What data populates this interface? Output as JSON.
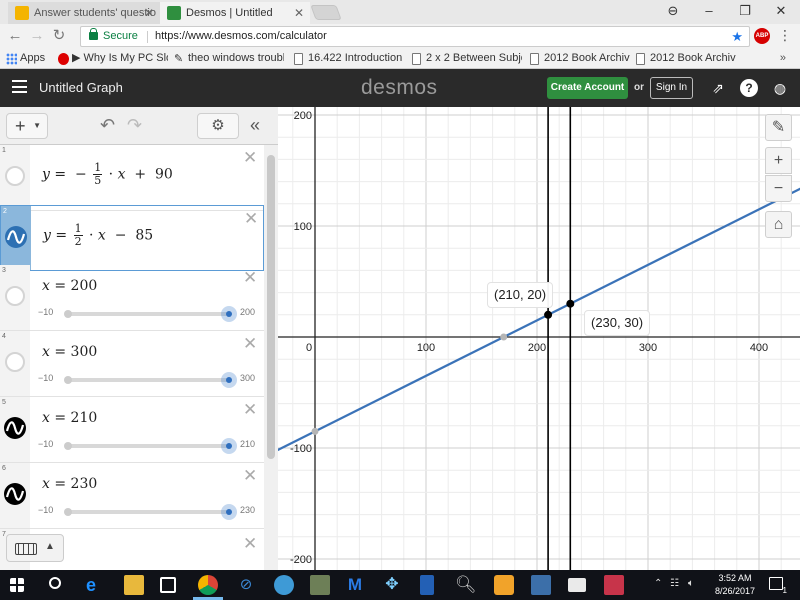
{
  "browser": {
    "tabs": [
      {
        "title": "Answer students' questio",
        "favicon_color": "#f4b400",
        "active": false
      },
      {
        "title": "Desmos | Untitled",
        "favicon_color": "#2f8f3f",
        "active": true
      }
    ],
    "secure_label": "Secure",
    "url": "https://www.desmos.com/calculator",
    "abp_label": "ABP",
    "bookmarks": [
      {
        "label": "Apps",
        "icon": "apps-icon"
      },
      {
        "label": "▶ Why Is My PC Slov",
        "icon": "power-icon"
      },
      {
        "label": "theo windows trouble",
        "icon": "bookmark-icon"
      },
      {
        "label": "16.422 Introduction",
        "icon": "page-icon"
      },
      {
        "label": "2 x 2 Between Subjec",
        "icon": "page-icon"
      },
      {
        "label": "2012 Book Archive",
        "icon": "page-icon"
      },
      {
        "label": "2012 Book Archive",
        "icon": "page-icon"
      }
    ],
    "bookmarks_more": "»"
  },
  "header": {
    "graph_title": "Untitled Graph",
    "logo": "desmos",
    "create_account": "Create Account",
    "or": "or",
    "sign_in": "Sign In"
  },
  "expressions": [
    {
      "num": "1",
      "icon": "empty-circle-icon"
    },
    {
      "num": "2",
      "icon": "blue-wave-icon",
      "color": "#2d70b3"
    },
    {
      "num": "3",
      "lhs": "x",
      "eq": "=",
      "value": "200",
      "min": "−10",
      "max": "200",
      "icon": "empty-circle-icon"
    },
    {
      "num": "4",
      "lhs": "x",
      "eq": "=",
      "value": "300",
      "min": "−10",
      "max": "300",
      "icon": "empty-circle-icon"
    },
    {
      "num": "5",
      "lhs": "x",
      "eq": "=",
      "value": "210",
      "min": "−10",
      "max": "210",
      "icon": "black-wave-icon",
      "color": "#000000"
    },
    {
      "num": "6",
      "lhs": "x",
      "eq": "=",
      "value": "230",
      "min": "−10",
      "max": "230",
      "icon": "black-wave-icon",
      "color": "#000000"
    },
    {
      "num": "7"
    }
  ],
  "expr1": {
    "y": "y",
    "eq": "=",
    "minus": "−",
    "num": "1",
    "den": "5",
    "dot": "·",
    "x": "x",
    "plus": "+",
    "c": "90"
  },
  "expr2": {
    "y": "y",
    "eq": "=",
    "num": "1",
    "den": "2",
    "dot": "·",
    "x": "x",
    "minus": "−",
    "c": "85"
  },
  "graph": {
    "x_ticks": [
      "0",
      "100",
      "200",
      "300",
      "400"
    ],
    "y_ticks": [
      "200",
      "100",
      "-100",
      "-200"
    ],
    "x_range": [
      -10,
      410
    ],
    "y_range": [
      -210,
      210
    ],
    "line_color": "#3b73b8",
    "line": {
      "slope": 0.5,
      "intercept": -85
    },
    "vertical_lines": [
      210,
      230
    ],
    "points": [
      {
        "x": 210,
        "y": 20,
        "label": "(210, 20)"
      },
      {
        "x": 230,
        "y": 30,
        "label": "(230, 30)"
      }
    ],
    "gray_points": [
      {
        "x": 170,
        "y": 0
      },
      {
        "x": 0,
        "y": -85
      }
    ]
  },
  "taskbar": {
    "time": "3:52 AM",
    "date": "8/26/2017"
  }
}
